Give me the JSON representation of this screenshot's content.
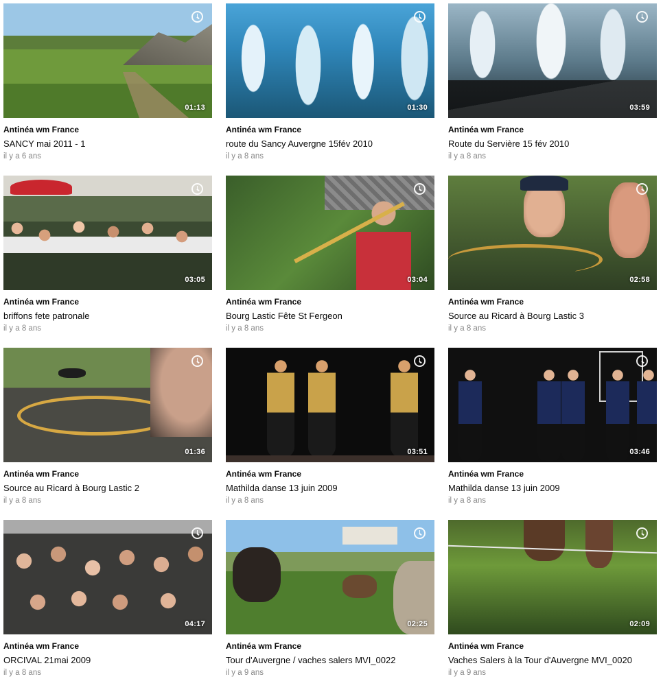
{
  "videos": [
    {
      "owner": "Antinéa wm France",
      "title": "SANCY mai 2011 - 1",
      "age": "il y a 6 ans",
      "duration": "01:13",
      "scene": "mountain"
    },
    {
      "owner": "Antinéa wm France",
      "title": "route du Sancy Auvergne 15fév 2010",
      "age": "il y a 8 ans",
      "duration": "01:30",
      "scene": "snowforest"
    },
    {
      "owner": "Antinéa wm France",
      "title": "Route du Servière 15 fév 2010",
      "age": "il y a 8 ans",
      "duration": "03:59",
      "scene": "snowroad"
    },
    {
      "owner": "Antinéa wm France",
      "title": "briffons fete patronale",
      "age": "il y a 8 ans",
      "duration": "03:05",
      "scene": "party"
    },
    {
      "owner": "Antinéa wm France",
      "title": "Bourg Lastic Fête St Fergeon",
      "age": "il y a 8 ans",
      "duration": "03:04",
      "scene": "trombone"
    },
    {
      "owner": "Antinéa wm France",
      "title": "Source au Ricard à Bourg Lastic 3",
      "age": "il y a 8 ans",
      "duration": "02:58",
      "scene": "bugle"
    },
    {
      "owner": "Antinéa wm France",
      "title": "Source au Ricard à Bourg Lastic 2",
      "age": "il y a 8 ans",
      "duration": "01:36",
      "scene": "band"
    },
    {
      "owner": "Antinéa wm France",
      "title": "Mathilda danse 13 juin 2009",
      "age": "il y a 8 ans",
      "duration": "03:51",
      "scene": "dance1"
    },
    {
      "owner": "Antinéa wm France",
      "title": "Mathilda danse 13 juin 2009",
      "age": "il y a 8 ans",
      "duration": "03:46",
      "scene": "dance2"
    },
    {
      "owner": "Antinéa wm France",
      "title": "ORCIVAL 21mai 2009",
      "age": "il y a 8 ans",
      "duration": "04:17",
      "scene": "crowd"
    },
    {
      "owner": "Antinéa wm France",
      "title": "Tour d'Auvergne / vaches salers MVI_0022",
      "age": "il y a 9 ans",
      "duration": "02:25",
      "scene": "cows"
    },
    {
      "owner": "Antinéa wm France",
      "title": "Vaches Salers à la Tour d'Auvergne MVI_0020",
      "age": "il y a 9 ans",
      "duration": "02:09",
      "scene": "fence"
    }
  ],
  "icons": {
    "watch_later": "clock-icon"
  }
}
